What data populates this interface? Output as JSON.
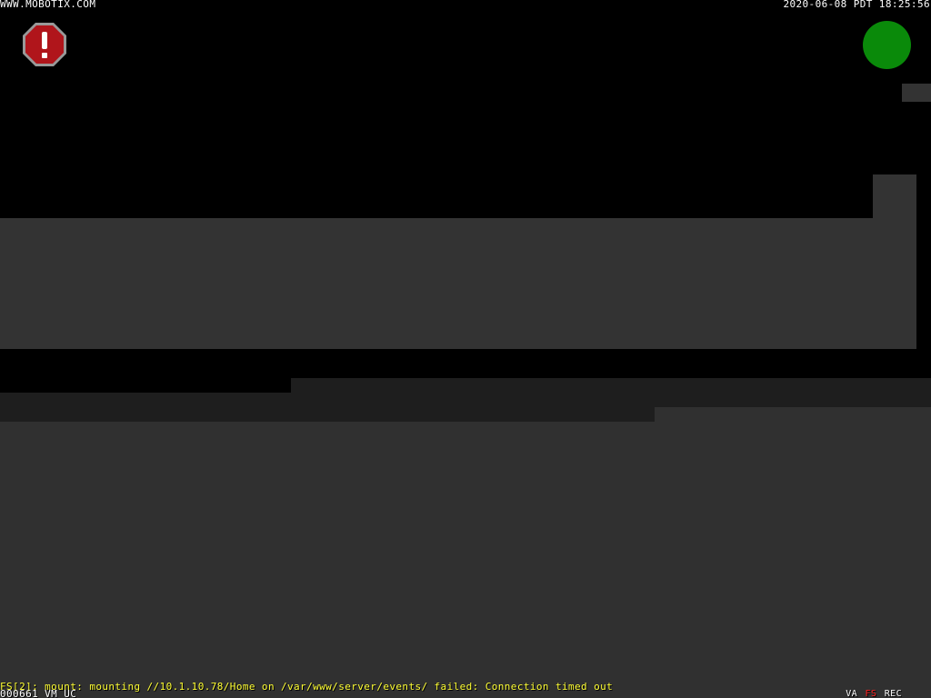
{
  "overlay": {
    "site_url": "WWW.MOBOTIX.COM",
    "timestamp": "2020-06-08 PDT 18:25:56",
    "error_message": "FS[2]: mount: mounting //10.1.10.78/Home on /var/www/server/events/ failed: Connection timed out",
    "frame_id": "000661 VM UC",
    "flags": {
      "va": "VA",
      "fs": "FS",
      "rec": "REC"
    }
  },
  "icons": {
    "alarm": "exclamation-octagon-icon",
    "status": "green-status-dot"
  },
  "colors": {
    "alarm_fill": "#b0151b",
    "alarm_border": "#999999",
    "status_dot": "#0a8a0a",
    "error_text": "#ffff33",
    "fs_flag": "#ff2020",
    "scene_gray": "#333333",
    "scene_dark": "#1e1e1e",
    "scene_floor": "#303030"
  }
}
